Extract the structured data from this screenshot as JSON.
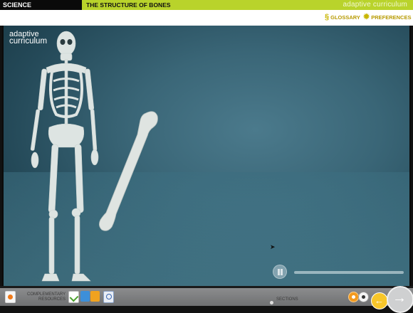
{
  "header": {
    "subject": "SCIENCE",
    "course_title": "THE STRUCTURE OF BONES",
    "brand": "adaptive curriculum"
  },
  "toolbar": {
    "glossary_label": "GLOSSARY",
    "glossary_icon": "glossary-icon",
    "preferences_label": "PREFERENCES",
    "preferences_icon": "gear-icon"
  },
  "stage": {
    "logo_line1": "adaptive",
    "logo_line2": "curriculum",
    "animation_progress": 0.0
  },
  "footer": {
    "complementary_label_line1": "COMPLEMENTARY",
    "complementary_label_line2": "RESOURCES",
    "sections_label": "SECTIONS",
    "resources": [
      "notes-icon",
      "checklist-icon",
      "document-icon",
      "folder-icon",
      "worksheet-icon"
    ],
    "section_markers": [
      "1",
      "2"
    ]
  },
  "colors": {
    "accent_green": "#b9d32b",
    "toolbar_gold": "#b79a00",
    "orange": "#f29a1f",
    "yellow": "#f7c62a"
  }
}
